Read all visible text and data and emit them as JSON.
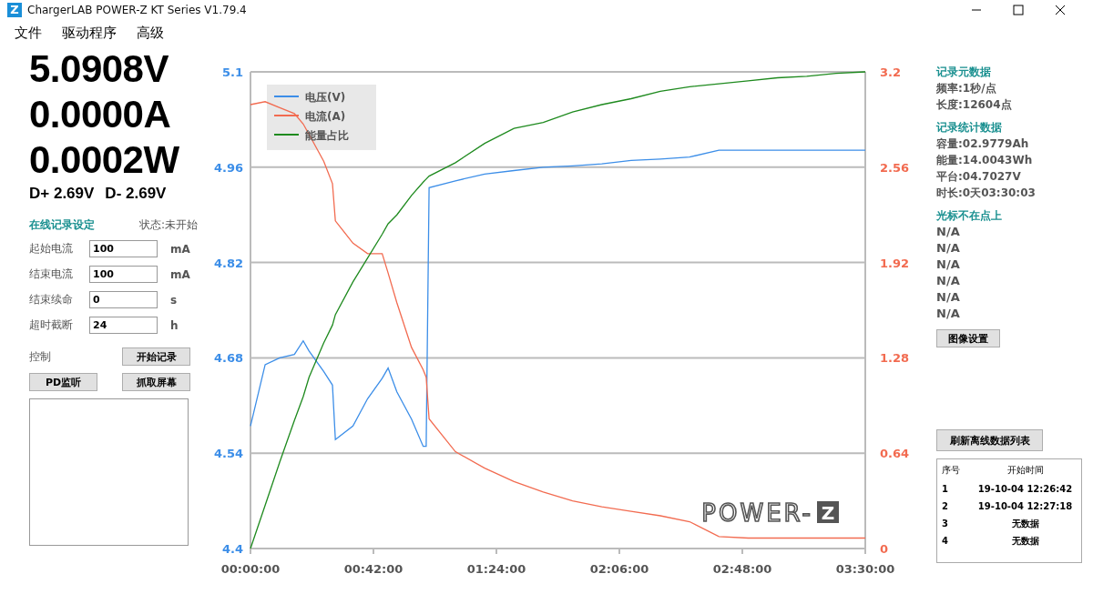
{
  "window": {
    "title": "ChargerLAB POWER-Z KT Series V1.79.4",
    "logo": "Z"
  },
  "menu": [
    "文件",
    "驱动程序",
    "高级"
  ],
  "readouts": {
    "voltage": "5.0908V",
    "current": "0.0000A",
    "power": "0.0002W",
    "dplus": "D+ 2.69V",
    "dminus": "D- 2.69V"
  },
  "online_record": {
    "title": "在线记录设定",
    "status": "状态:未开始",
    "fields": [
      {
        "label": "起始电流",
        "value": "100",
        "unit": "mA"
      },
      {
        "label": "结束电流",
        "value": "100",
        "unit": "mA"
      },
      {
        "label": "结束续命",
        "value": "0",
        "unit": "s"
      },
      {
        "label": "超时截断",
        "value": "24",
        "unit": "h"
      }
    ]
  },
  "control": {
    "label": "控制",
    "buttons": [
      "开始记录",
      "PD监听",
      "抓取屏幕"
    ]
  },
  "chart": {
    "logo": "POWER-",
    "logo_box": "Z",
    "chart_data": {
      "type": "line",
      "x": [
        0,
        5,
        10,
        15,
        18,
        20,
        25,
        28,
        29,
        35,
        40,
        45,
        47,
        50,
        55,
        59,
        60,
        61,
        70,
        80,
        90,
        100,
        110,
        120,
        130,
        140,
        150,
        160,
        170,
        180,
        190,
        200,
        210
      ],
      "xlim": [
        0,
        210
      ],
      "ylim": [
        4.4,
        5.1
      ],
      "y2lim": [
        0,
        3.2
      ],
      "grid": true,
      "legend": true,
      "y2ticks": [
        {
          "value": 3.2,
          "label": "3.2"
        },
        {
          "value": 2.56,
          "label": "2.56"
        },
        {
          "value": 1.92,
          "label": "1.92"
        },
        {
          "value": 1.28,
          "label": "1.28"
        },
        {
          "value": 0.64,
          "label": "0.64"
        },
        {
          "value": 0,
          "label": "0"
        }
      ],
      "xticks": [
        {
          "value": 0,
          "label": "00:00:00"
        },
        {
          "value": 42,
          "label": "00:42:00"
        },
        {
          "value": 84,
          "label": "01:24:00"
        },
        {
          "value": 126,
          "label": "02:06:00"
        },
        {
          "value": 168,
          "label": "02:48:00"
        },
        {
          "value": 210,
          "label": "03:30:00"
        }
      ],
      "yticks": [
        {
          "value": 5.1,
          "label": "5.1"
        },
        {
          "value": 4.96,
          "label": "4.96"
        },
        {
          "value": 4.82,
          "label": "4.82"
        },
        {
          "value": 4.68,
          "label": "4.68"
        },
        {
          "value": 4.54,
          "label": "4.54"
        },
        {
          "value": 4.4,
          "label": "4.4"
        }
      ],
      "series": [
        {
          "name": "电压(V)",
          "color": "#3c8ee8",
          "axis": "y",
          "values": [
            4.58,
            4.67,
            4.68,
            4.685,
            4.705,
            4.69,
            4.66,
            4.64,
            4.56,
            4.58,
            4.62,
            4.65,
            4.665,
            4.63,
            4.59,
            4.55,
            4.55,
            4.93,
            4.94,
            4.95,
            4.955,
            4.96,
            4.962,
            4.965,
            4.97,
            4.972,
            4.975,
            4.985,
            4.985,
            4.985,
            4.985,
            4.985,
            4.985
          ]
        },
        {
          "name": "电流(A)",
          "color": "#f26b50",
          "axis": "y2",
          "values": [
            2.98,
            3.0,
            2.96,
            2.92,
            2.85,
            2.78,
            2.6,
            2.45,
            2.2,
            2.05,
            1.98,
            1.98,
            1.85,
            1.65,
            1.35,
            1.2,
            1.15,
            0.87,
            0.65,
            0.54,
            0.45,
            0.38,
            0.32,
            0.28,
            0.25,
            0.22,
            0.18,
            0.08,
            0.07,
            0.07,
            0.07,
            0.07,
            0.07
          ]
        },
        {
          "name": "能量占比",
          "color": "#1e8a1e",
          "axis": "y2",
          "values": [
            0,
            0.29,
            0.58,
            0.86,
            1.02,
            1.15,
            1.38,
            1.5,
            1.57,
            1.79,
            1.95,
            2.11,
            2.18,
            2.24,
            2.37,
            2.46,
            2.48,
            2.5,
            2.59,
            2.72,
            2.82,
            2.86,
            2.93,
            2.98,
            3.02,
            3.07,
            3.1,
            3.12,
            3.14,
            3.16,
            3.17,
            3.19,
            3.2
          ]
        }
      ]
    }
  },
  "record_meta": {
    "title": "记录元数据",
    "lines": [
      "频率:1秒/点",
      "长度:12604点"
    ]
  },
  "record_stats": {
    "title": "记录统计数据",
    "lines": [
      "容量:02.9779Ah",
      "能量:14.0043Wh",
      "平台:04.7027V",
      "时长:0天03:30:03"
    ]
  },
  "cursor": {
    "title": "光标不在点上",
    "lines": [
      "N/A",
      "N/A",
      "N/A",
      "N/A",
      "N/A",
      "N/A"
    ]
  },
  "image_settings_button": "图像设置",
  "refresh_button": "刷新离线数据列表",
  "offline_table": {
    "columns": [
      "序号",
      "开始时间"
    ],
    "rows": [
      [
        "1",
        "19-10-04 12:26:42"
      ],
      [
        "2",
        "19-10-04 12:27:18"
      ],
      [
        "3",
        "无数据"
      ],
      [
        "4",
        "无数据"
      ]
    ]
  }
}
